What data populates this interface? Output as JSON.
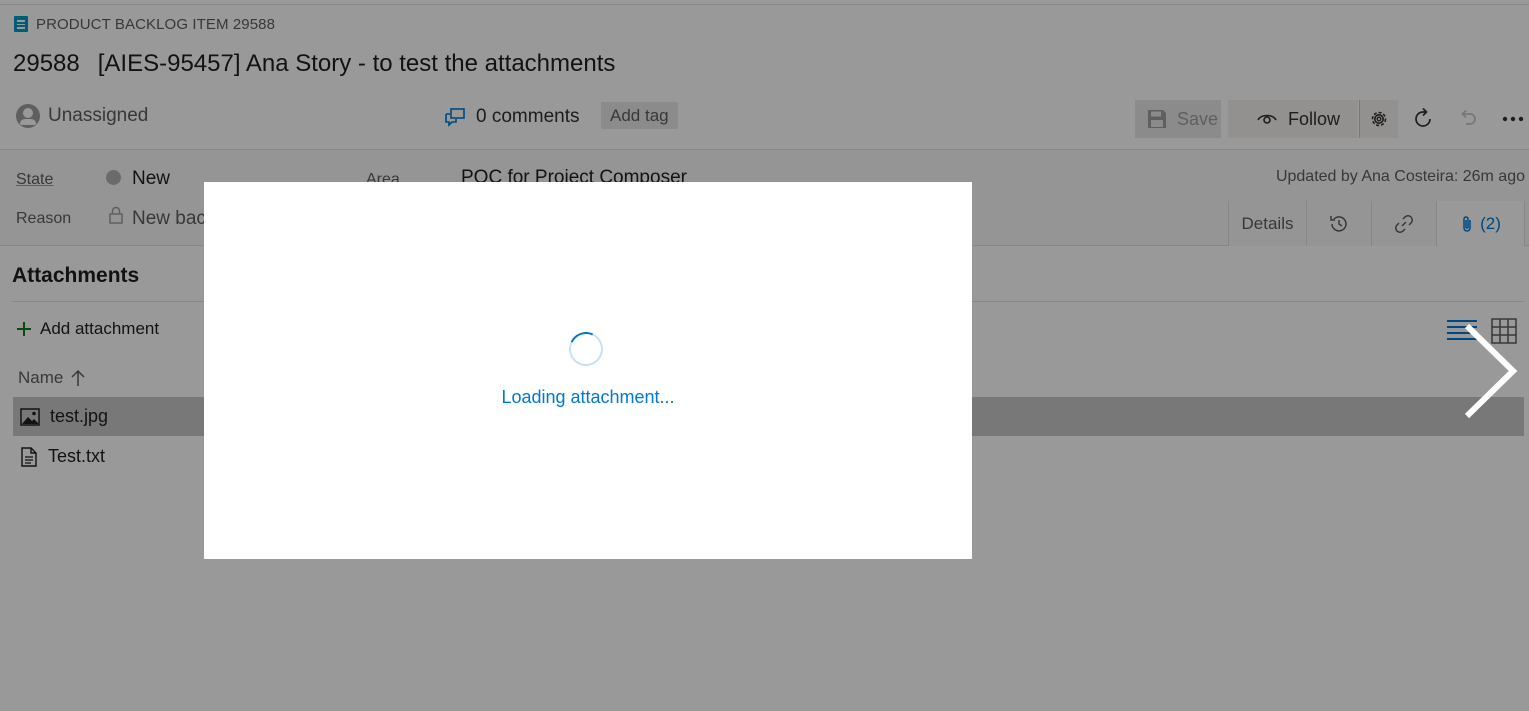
{
  "header": {
    "type_label": "PRODUCT BACKLOG ITEM 29588",
    "item_id": "29588",
    "item_title": "[AIES-95457] Ana Story - to test the attachments"
  },
  "toolbar": {
    "assignee": "Unassigned",
    "comments": "0 comments",
    "add_tag": "Add tag",
    "save": "Save",
    "follow": "Follow"
  },
  "fields": {
    "state_label": "State",
    "state_value": "New",
    "reason_label": "Reason",
    "reason_value": "New bac",
    "area_label": "Area",
    "area_value": "POC for Project Composer",
    "updated": "Updated by Ana Costeira: 26m ago"
  },
  "tabs": {
    "details": "Details",
    "attachments_count": "(2)"
  },
  "attachments": {
    "title": "Attachments",
    "add_label": "Add attachment",
    "name_header": "Name",
    "files": [
      {
        "name": "test.jpg",
        "icon": "image-file-icon",
        "selected": true
      },
      {
        "name": "Test.txt",
        "icon": "text-file-icon",
        "selected": false
      }
    ]
  },
  "modal": {
    "loading_text": "Loading attachment..."
  },
  "colors": {
    "accent": "#0078d4",
    "work_item_type": "#009ccc",
    "add_icon": "#107c10"
  }
}
